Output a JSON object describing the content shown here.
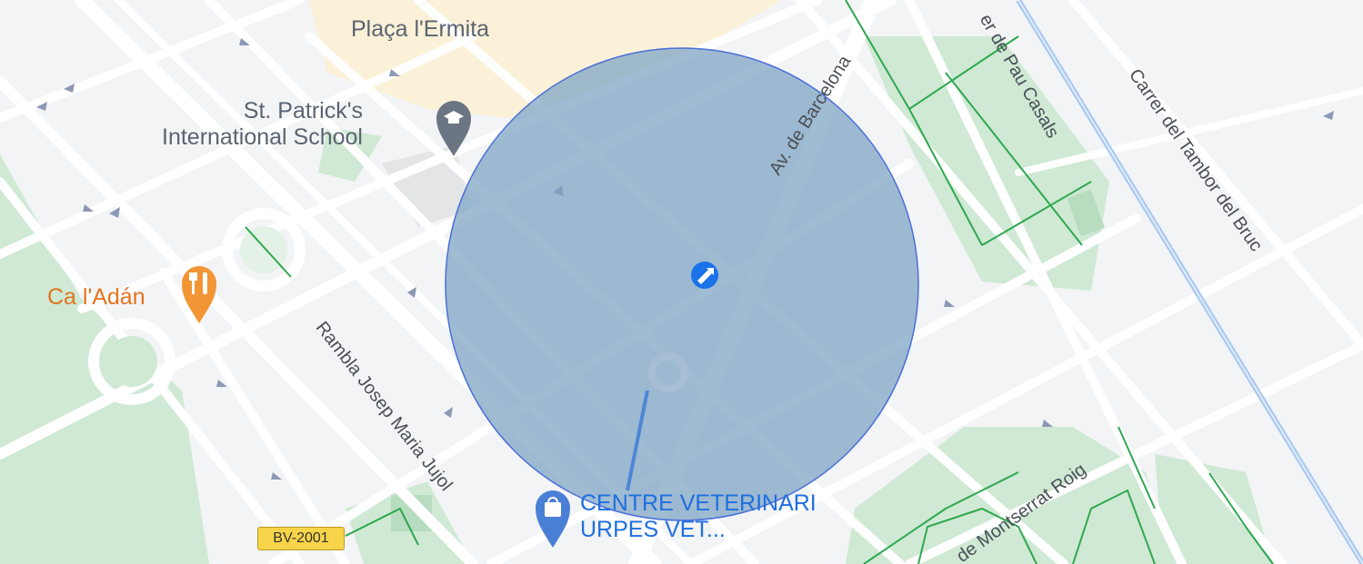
{
  "map": {
    "pois": {
      "school_line1": "St. Patrick's",
      "school_line2": "International School",
      "plaza": "Plaça l'Ermita",
      "restaurant": "Ca l'Adán",
      "vet_line1": "CENTRE VETERINARI",
      "vet_line2": "URPES VET..."
    },
    "streets": {
      "av_barcelona": "Av. de Barcelona",
      "pau_casals": "er de Pau Casals",
      "tambor_bruc": "Carrer del Tambor del Bruc",
      "rambla_jujol": "Rambla Josep Maria Jujol",
      "montserrat_roig": "de Montserrat Roig"
    },
    "road_badge": "BV-2001",
    "colors": {
      "background": "#f3f4f6",
      "road": "#ffffff",
      "park": "#cfe9d4",
      "path": "#2fa84f",
      "residential": "#fbf1d8",
      "circle_fill": "#7fa5c4",
      "circle_stroke": "#4a6fd8",
      "restaurant": "#f29534",
      "vet": "#1f6fe0",
      "railway": "#a8c8f0"
    },
    "icons": [
      "school-icon",
      "restaurant-icon",
      "vet-shopping-icon",
      "location-marker-icon"
    ]
  }
}
